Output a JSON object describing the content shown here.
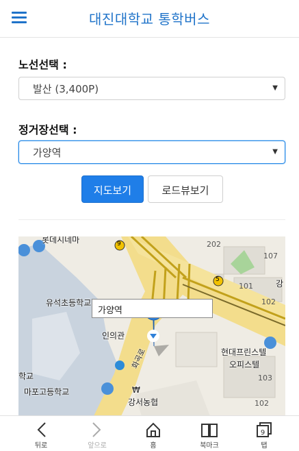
{
  "header": {
    "title": "대진대학교 통학버스"
  },
  "route": {
    "label": "노선선택 :",
    "selected": "발산 (3,400P)"
  },
  "stop": {
    "label": "정거장선택 :",
    "selected": "가양역"
  },
  "buttons": {
    "map": "지도보기",
    "roadview": "로드뷰보기"
  },
  "map": {
    "callout": "가양역",
    "places": {
      "school1": "유석초등학교",
      "office": "인의관",
      "bank": "강서농협",
      "highschool": "마포고등학교",
      "school2": "학교",
      "apt": "현대프린스텔",
      "apt2": "오피스텔",
      "road": "화곡로",
      "top": "롯데시네마",
      "right": "강",
      "won": "₩"
    },
    "numbers": [
      "107",
      "101",
      "102",
      "103",
      "102",
      "202"
    ],
    "routes": [
      "9",
      "5",
      "9"
    ]
  },
  "bottom_nav": [
    {
      "name": "back",
      "label": "뒤로",
      "icon": "chevron-left-icon"
    },
    {
      "name": "forward",
      "label": "앞으로",
      "icon": "chevron-right-icon"
    },
    {
      "name": "home",
      "label": "홈",
      "icon": "home-icon"
    },
    {
      "name": "bookmark",
      "label": "북마크",
      "icon": "book-icon"
    },
    {
      "name": "tabs",
      "label": "탭",
      "icon": "tabs-icon",
      "count": "9"
    }
  ],
  "colors": {
    "accent": "#1f73c9",
    "primary_button": "#1f7ee8"
  }
}
